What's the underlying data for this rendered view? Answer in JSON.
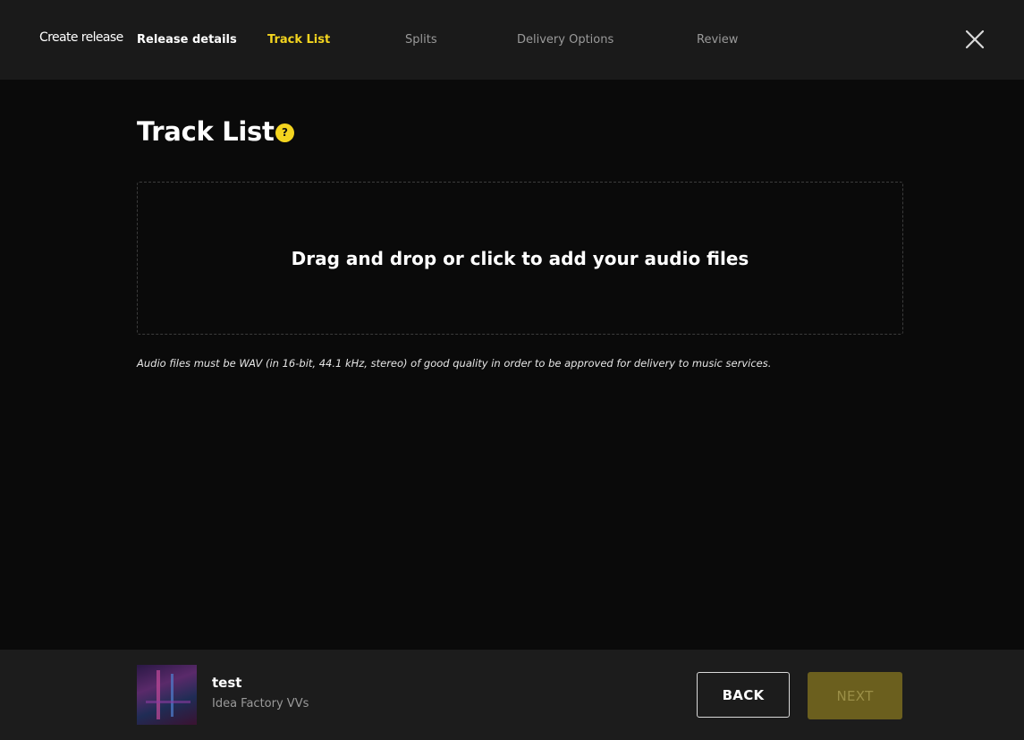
{
  "header": {
    "brand": "Create release",
    "steps": [
      {
        "label": "Release details",
        "state": "done"
      },
      {
        "label": "Track List",
        "state": "active"
      },
      {
        "label": "Splits",
        "state": "upcoming"
      },
      {
        "label": "Delivery Options",
        "state": "upcoming"
      },
      {
        "label": "Review",
        "state": "upcoming"
      }
    ],
    "close_icon": "close-icon"
  },
  "main": {
    "title": "Track List",
    "help_icon_glyph": "?",
    "dropzone_text": "Drag and drop or click to add your audio files",
    "note": "Audio files must be WAV (in 16-bit, 44.1 kHz, stereo) of good quality in order to be approved for delivery to music services."
  },
  "footer": {
    "release_title": "test",
    "release_artist": "Idea Factory VVs",
    "back_label": "BACK",
    "next_label": "NEXT"
  },
  "colors": {
    "accent": "#f3d41f",
    "background": "#0a0a0a",
    "topbar": "#1a1a1a",
    "footer": "#1c1c1c",
    "next_disabled": "#6b5f1e"
  }
}
